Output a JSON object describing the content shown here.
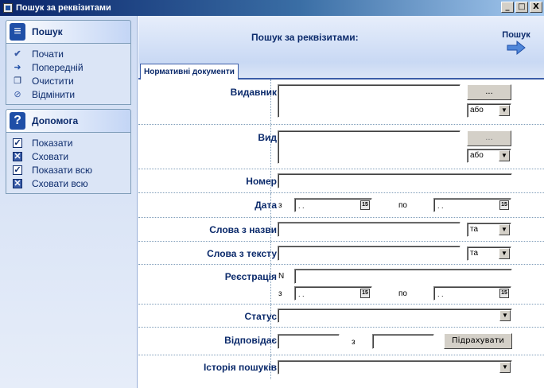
{
  "window": {
    "title": "Пошук за реквізитами",
    "min": "_",
    "max": "□",
    "close": "X"
  },
  "sidebar": {
    "search_panel": {
      "title": "Пошук",
      "items": [
        {
          "label": "Почати",
          "icon": "start-icon"
        },
        {
          "label": "Попередній",
          "icon": "previous-icon"
        },
        {
          "label": "Очистити",
          "icon": "clear-icon"
        },
        {
          "label": "Відмінити",
          "icon": "cancel-icon"
        }
      ]
    },
    "help_panel": {
      "title": "Допомога",
      "items": [
        {
          "label": "Показати",
          "icon": "checkbox-checked-icon"
        },
        {
          "label": "Сховати",
          "icon": "checkbox-x-icon"
        },
        {
          "label": "Показати всю",
          "icon": "checkbox-checked-icon"
        },
        {
          "label": "Сховати всю",
          "icon": "checkbox-x-icon"
        }
      ]
    }
  },
  "header": {
    "title": "Пошук за реквізитами:",
    "search_label": "Пошук"
  },
  "tabs": [
    {
      "label": "Нормативні документи"
    }
  ],
  "form": {
    "publisher": {
      "label": "Видавник",
      "browse": "...",
      "logic": "або"
    },
    "type": {
      "label": "Вид",
      "browse": "...",
      "logic": "або"
    },
    "number": {
      "label": "Номер",
      "value": ""
    },
    "date": {
      "label": "Дата",
      "from": "з",
      "to": "по",
      "from_value": ". .",
      "to_value": ". .",
      "cal": "15"
    },
    "title_words": {
      "label": "Слова з назви",
      "logic": "та"
    },
    "text_words": {
      "label": "Слова з тексту",
      "logic": "та"
    },
    "registration": {
      "label": "Реєстрація",
      "n": "N",
      "from": "з",
      "to": "по",
      "from_value": ". .",
      "to_value": ". .",
      "cal": "15"
    },
    "status": {
      "label": "Статус",
      "value": ""
    },
    "matches": {
      "label": "Відповідає",
      "from": "з",
      "count_button": "Підрахувати"
    },
    "history": {
      "label": "Історія пошуків",
      "value": ""
    }
  },
  "colors": {
    "accent": "#0b2a6b",
    "title_gradient_start": "#0a246a",
    "sidebar_bg": "#cfdcf3"
  }
}
